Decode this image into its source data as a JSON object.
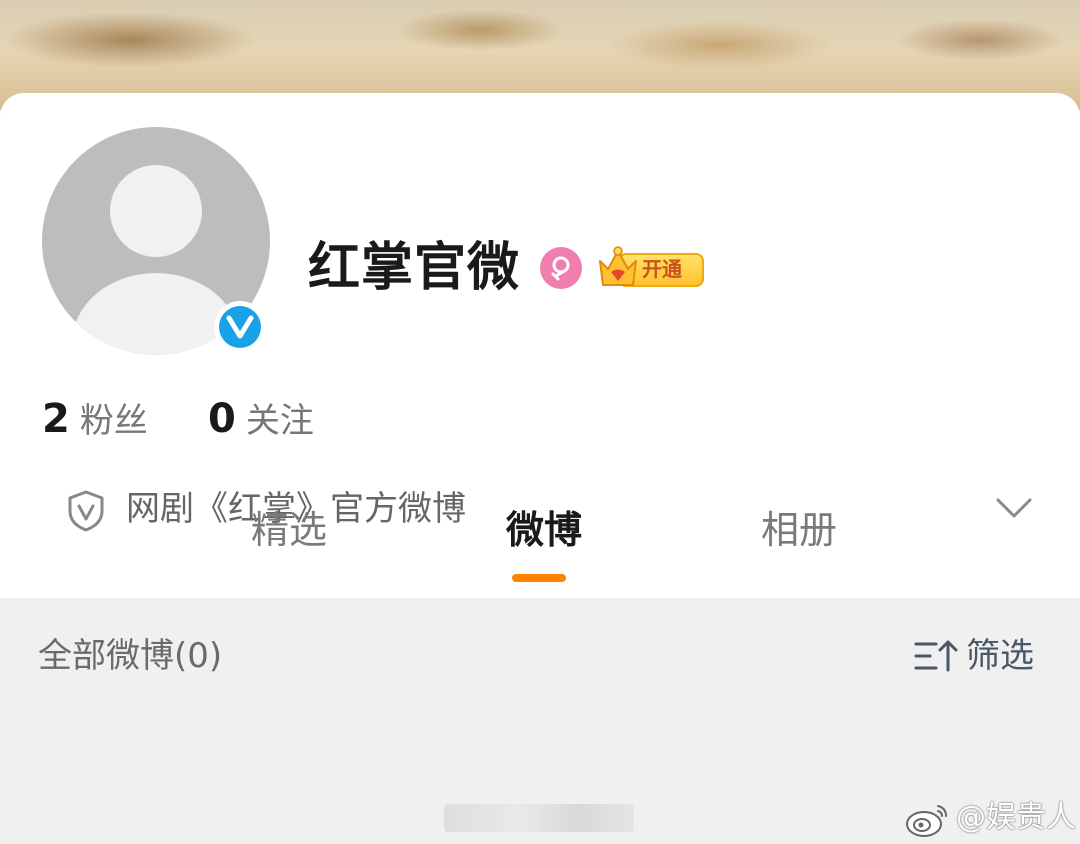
{
  "profile": {
    "name": "红掌官微",
    "vip_label": "开通",
    "description": "网剧《红掌》官方微博"
  },
  "stats": [
    {
      "value": "2",
      "label": "粉丝"
    },
    {
      "value": "0",
      "label": "关注"
    }
  ],
  "tabs": [
    {
      "label": "精选"
    },
    {
      "label": "微博"
    },
    {
      "label": "相册"
    }
  ],
  "active_tab": "微博",
  "feed": {
    "all_label": "全部微博(0)",
    "filter_label": "筛选"
  },
  "watermark": {
    "text": "@娱贵人"
  },
  "colors": {
    "accent": "#ff8200",
    "verified": "#1aa2e8",
    "gender_female": "#f07fb0",
    "vip_gold": "#ffc22e"
  },
  "icons": {
    "verified": "verified-v-icon",
    "gender": "female-icon",
    "vip": "crown-icon",
    "description": "shield-v-icon",
    "expand": "chevron-down-icon",
    "filter": "filter-sort-icon",
    "watermark": "weibo-logo-icon"
  }
}
